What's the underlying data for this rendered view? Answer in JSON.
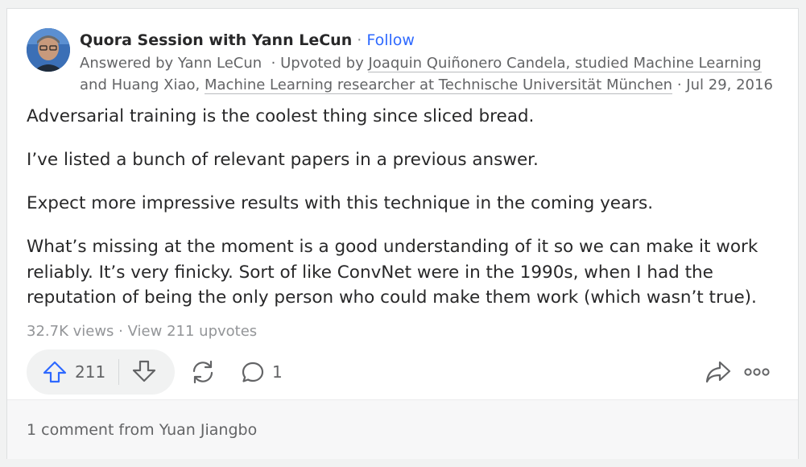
{
  "header": {
    "author": "Quora Session with Yann LeCun",
    "separator": "·",
    "follow_label": "Follow",
    "answered_by": "Answered by Yann LeCun",
    "upvoted_prefix": "Upvoted by",
    "upvoter1": "Joaquin Quiñonero Candela, studied Machine Learning",
    "and_word": "and",
    "upvoter2_name": "Huang Xiao,",
    "upvoter2_credential": "Machine Learning researcher at Technische Universität München",
    "date": "Jul 29, 2016"
  },
  "answer": {
    "paragraphs": [
      "Adversarial training is the coolest thing since sliced bread.",
      "I’ve listed a bunch of relevant papers in a previous answer.",
      "Expect more impressive results with this technique in the coming years.",
      "What’s missing at the moment is a good understanding of it so we can make it work reliably. It’s very finicky. Sort of like ConvNet were in the 1990s, when I had the reputation of being the only person who could make them work (which wasn’t true)."
    ]
  },
  "stats": {
    "views": "32.7K views",
    "separator": "·",
    "upvotes_link": "View 211 upvotes"
  },
  "actions": {
    "upvote_count": "211",
    "comment_count": "1",
    "icons": [
      "upvote-icon",
      "downvote-icon",
      "share-icon",
      "comment-icon",
      "forward-icon",
      "more-icon"
    ]
  },
  "comments": {
    "summary": "1 comment from Yuan Jiangbo"
  },
  "colors": {
    "accent": "#2e69ff",
    "text": "#282829",
    "muted": "#636466",
    "light": "#939598",
    "pill": "#f1f2f2"
  }
}
